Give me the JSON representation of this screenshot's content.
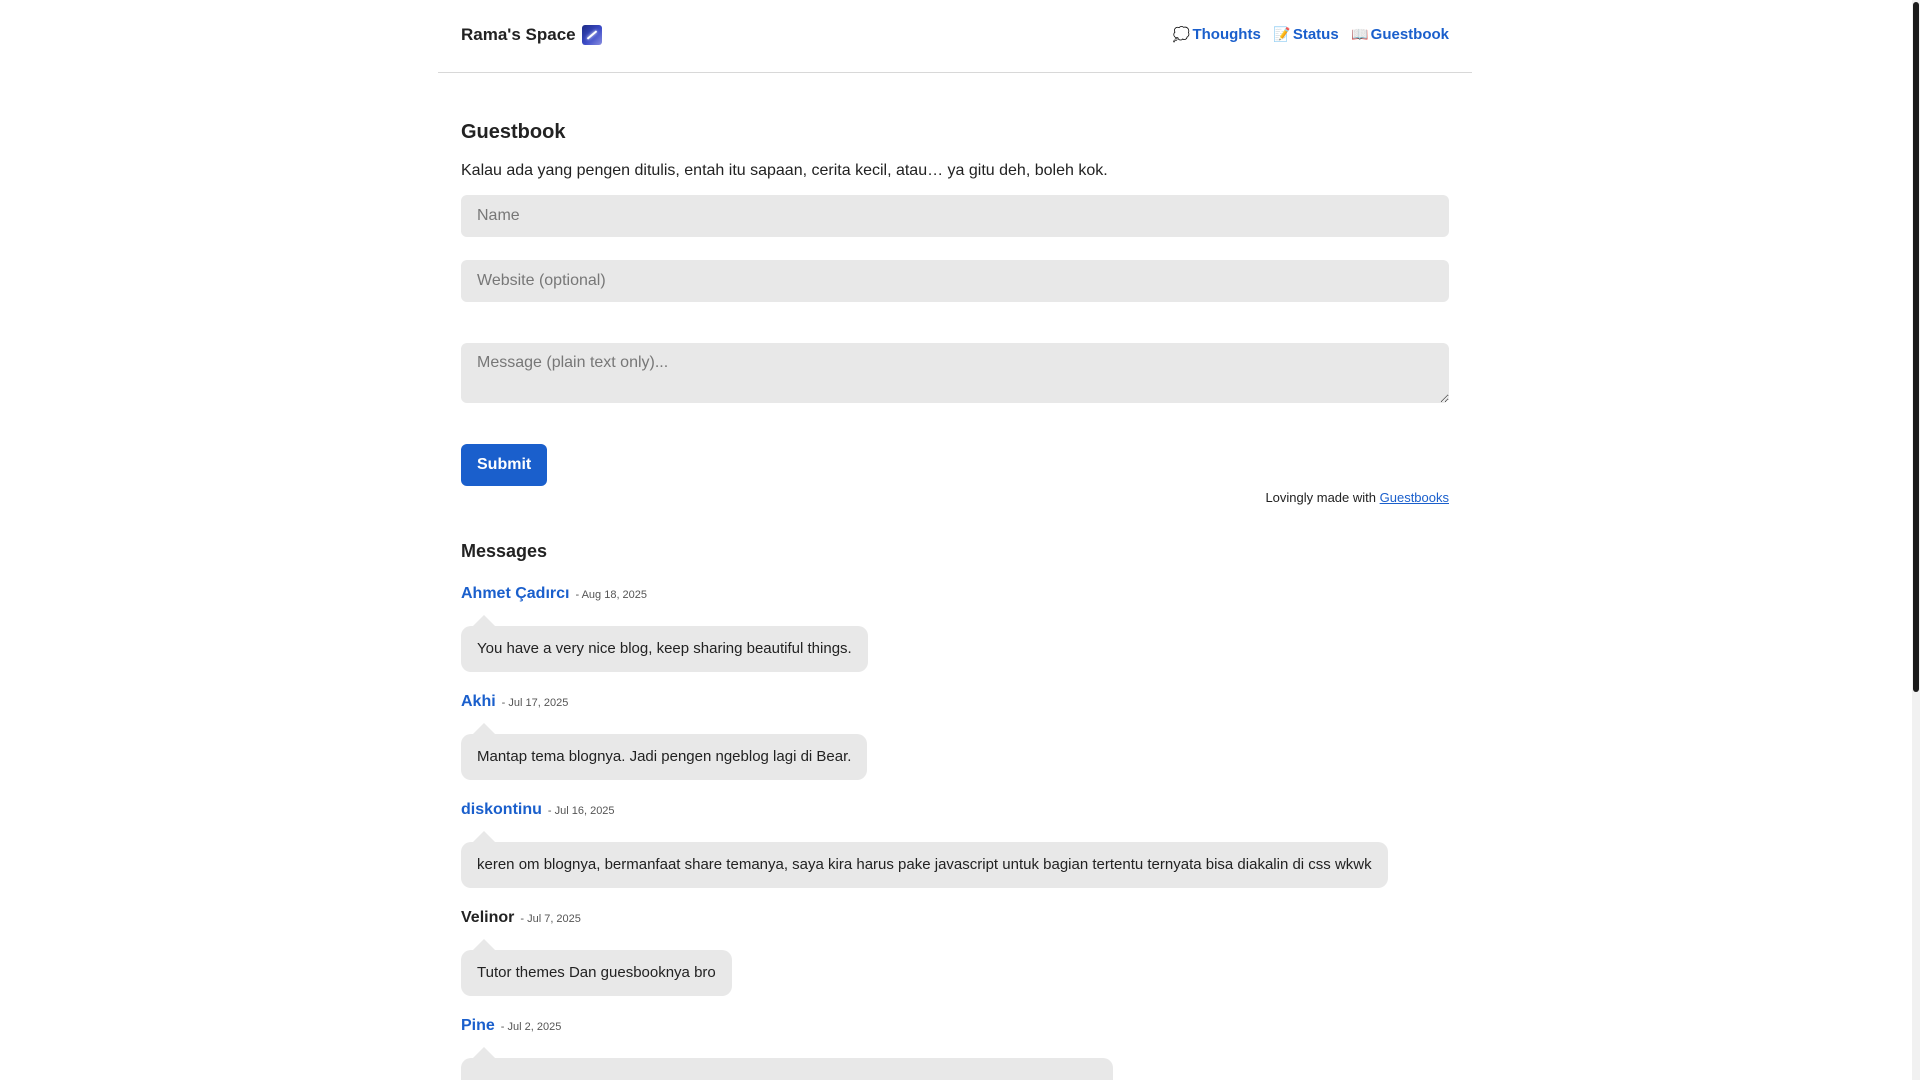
{
  "header": {
    "brand": "Rama's Space",
    "brand_icon": "shooting-star-icon",
    "nav": [
      {
        "label": "Thoughts",
        "icon": "speech-bubble-icon",
        "glyph": "💭"
      },
      {
        "label": "Status",
        "icon": "memo-icon",
        "glyph": "📝"
      },
      {
        "label": "Guestbook",
        "icon": "open-book-icon",
        "glyph": "📖"
      }
    ]
  },
  "guestbook": {
    "title": "Guestbook",
    "intro": "Kalau ada yang pengen ditulis, entah itu sapaan, cerita kecil, atau… ya gitu deh, boleh kok.",
    "name_placeholder": "Name",
    "website_placeholder": "Website (optional)",
    "message_placeholder": "Message (plain text only)...",
    "submit_label": "Submit",
    "credit_prefix": "Lovingly made with",
    "credit_link": "Guestbooks"
  },
  "messages": {
    "title": "Messages",
    "items": [
      {
        "author": "Ahmet Çadırcı",
        "linked": true,
        "date": "- Aug 18, 2025",
        "text": "You have a very nice blog, keep sharing beautiful things."
      },
      {
        "author": "Akhi",
        "linked": true,
        "date": "- Jul 17, 2025",
        "text": "Mantap tema blognya. Jadi pengen ngeblog lagi di Bear."
      },
      {
        "author": "diskontinu",
        "linked": true,
        "date": "- Jul 16, 2025",
        "text": "keren om blognya, bermanfaat share temanya, saya kira harus pake javascript untuk bagian tertentu ternyata bisa diakalin di css wkwk"
      },
      {
        "author": "Velinor",
        "linked": false,
        "date": "- Jul 7, 2025",
        "text": "Tutor themes Dan guesbooknya bro"
      },
      {
        "author": "Pine",
        "linked": true,
        "date": "- Jul 2, 2025",
        "text": ""
      }
    ]
  },
  "colors": {
    "accent": "#1a5fcc",
    "field_bg": "#e8e8e8",
    "text": "#222222"
  }
}
